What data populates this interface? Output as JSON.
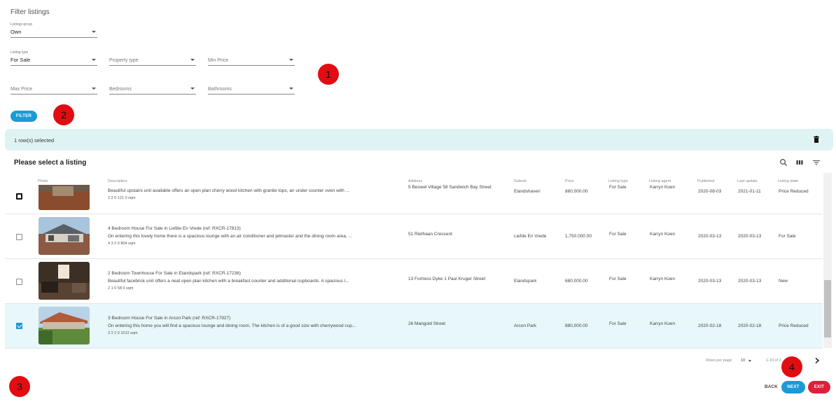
{
  "filter": {
    "title": "Filter listings",
    "listings_group": {
      "label": "Listings group",
      "value": "Own"
    },
    "listing_type": {
      "label": "Listing type",
      "value": "For Sale"
    },
    "property_type": {
      "placeholder": "Property type"
    },
    "min_price": {
      "placeholder": "Min Price"
    },
    "max_price": {
      "placeholder": "Max Price"
    },
    "bedrooms": {
      "placeholder": "Bedrooms"
    },
    "bathrooms": {
      "placeholder": "Bathrooms"
    },
    "filter_button": "FILTER"
  },
  "badges": [
    "1",
    "2",
    "3",
    "4"
  ],
  "selection": {
    "text": "1 row(s) selected"
  },
  "table": {
    "title": "Please select a listing",
    "columns": [
      "Photo",
      "Description",
      "Address",
      "Suburb",
      "Price",
      "Listing type",
      "Listing agent",
      "Published",
      "Last update",
      "Listing state"
    ],
    "rows": [
      {
        "title": "",
        "description": "Beautiful upstairs unit available offers an open plan cherry wood kitchen with granite tops, an under counter oven with ...",
        "specs": "2  2  0  121  0 sqm",
        "address": "5 Beswel Village 58 Sandwich Bay Street",
        "suburb": "Elandshaven",
        "price": "880,000.00",
        "listing_type": "For Sale",
        "agent": "Karryn Koen",
        "published": "2020-08-03",
        "last_update": "2021-01-11",
        "state": "Price Reduced",
        "checked": false
      },
      {
        "title": "4 Bedroom House For Sale in Liefde En Vrede (ref: RXCR-17813)",
        "description": "On entering this lovely home there is a spacious lounge with an air conditioner and jetmaster and the dining room area, ...",
        "specs": "4  3  2  0  804 sqm",
        "address": "51 Riethaan Crescent",
        "suburb": "Liefde En Vrede",
        "price": "1,750,000.00",
        "listing_type": "For Sale",
        "agent": "Karryn Koen",
        "published": "2020-03-13",
        "last_update": "2020-03-13",
        "state": "For Sale",
        "checked": false
      },
      {
        "title": "2 Bedroom Townhouse For Sale in Elandspark (ref: RXCR-17236)",
        "description": "Beautiful facebrick unit offers a neat open plan kitchen with a breakfast counter and additional cupboards. A spacious l...",
        "specs": "2  1  0  58  0 sqm",
        "address": "13 Fortress Dyke 1 Paul Kruger Street",
        "suburb": "Elandspark",
        "price": "680,000.00",
        "listing_type": "For Sale",
        "agent": "Karryn Koen",
        "published": "2020-03-13",
        "last_update": "2020-03-13",
        "state": "New",
        "checked": false
      },
      {
        "title": "3 Bedroom House For Sale in Arcon Park (ref: RXCR-17927)",
        "description": "On entering this home you will find a spacious lounge and dining room. The kitchen is of a good size with cherrywood cup...",
        "specs": "3  2  2  0  1012 sqm",
        "address": "26 Marigold Street",
        "suburb": "Arcon Park",
        "price": "880,000.00",
        "listing_type": "For Sale",
        "agent": "Karryn Koen",
        "published": "2020-02-18",
        "last_update": "2020-02-18",
        "state": "Price Reduced",
        "checked": true
      }
    ]
  },
  "pagination": {
    "rows_per_page_label": "Rows per page:",
    "rows_per_page": "10",
    "range": "1-10 of 2..."
  },
  "footer": {
    "back": "BACK",
    "next": "NEXT",
    "exit": "EXIT"
  },
  "colors": {
    "accent": "#1c9ad6",
    "exit": "#e0203a",
    "badge": "#e10d12",
    "selection_bar": "#dff3f5"
  }
}
